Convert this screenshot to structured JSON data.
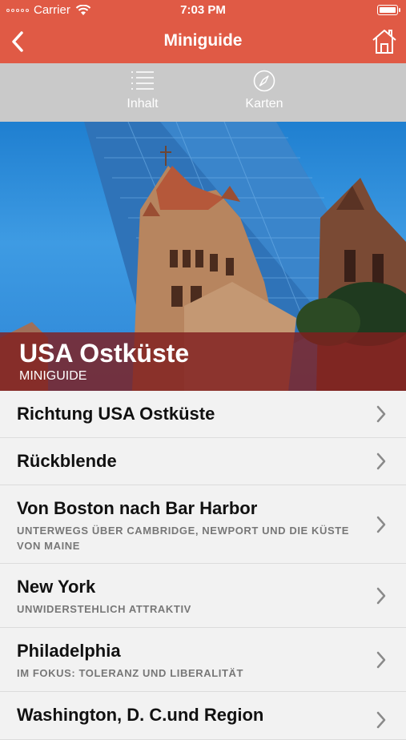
{
  "status_bar": {
    "carrier": "Carrier",
    "time": "7:03 PM"
  },
  "nav": {
    "title": "Miniguide",
    "back_icon": "chevron-left-icon",
    "home_icon": "home-icon"
  },
  "tabs": [
    {
      "label": "Inhalt",
      "icon": "list-icon"
    },
    {
      "label": "Karten",
      "icon": "compass-icon"
    }
  ],
  "hero": {
    "title": "USA Ostküste",
    "subtitle": "MINIGUIDE"
  },
  "items": [
    {
      "title": "Richtung USA Ostküste",
      "subtitle": ""
    },
    {
      "title": "Rückblende",
      "subtitle": ""
    },
    {
      "title": "Von Boston nach Bar Harbor",
      "subtitle": "UNTERWEGS ÜBER CAMBRIDGE, NEWPORT UND DIE KÜSTE VON MAINE"
    },
    {
      "title": "New York",
      "subtitle": "UNWIDERSTEHLICH ATTRAKTIV"
    },
    {
      "title": "Philadelphia",
      "subtitle": "IM FOKUS: TOLERANZ UND LIBERALITÄT"
    },
    {
      "title": "Washington, D. C.und Region",
      "subtitle": ""
    }
  ],
  "colors": {
    "accent": "#e05a45",
    "tab_bar": "#c9c9c9",
    "hero_overlay": "#801e1e"
  }
}
